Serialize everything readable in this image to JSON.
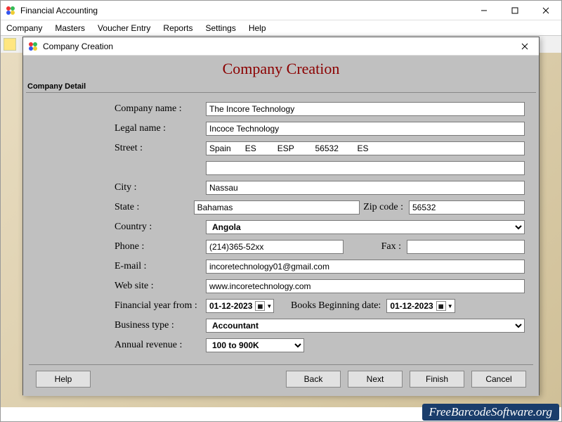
{
  "mainWindow": {
    "title": "Financial Accounting"
  },
  "menubar": {
    "items": [
      "Company",
      "Masters",
      "Voucher Entry",
      "Reports",
      "Settings",
      "Help"
    ]
  },
  "dialog": {
    "title": "Company Creation",
    "heading": "Company Creation",
    "groupLabel": "Company Detail"
  },
  "labels": {
    "companyName": "Company name :",
    "legalName": "Legal name :",
    "street": "Street :",
    "city": "City :",
    "state": "State :",
    "zip": "Zip code :",
    "country": "Country :",
    "phone": "Phone :",
    "fax": "Fax :",
    "email": "E-mail :",
    "website": "Web site :",
    "fyFrom": "Financial year from :",
    "booksBegin": "Books Beginning date:",
    "businessType": "Business type :",
    "annualRevenue": "Annual revenue :"
  },
  "values": {
    "companyName": "The Incore Technology",
    "legalName": "Incoce Technology",
    "street1": "Spain      ES         ESP         56532        ES",
    "street2": "",
    "city": "Nassau",
    "state": "Bahamas",
    "zip": "56532",
    "country": "Angola",
    "phone": "(214)365-52xx",
    "fax": "",
    "email": "incoretechnology01@gmail.com",
    "website": "www.incoretechnology.com",
    "fyFrom": "01-12-2023",
    "booksBegin": "01-12-2023",
    "businessType": "Accountant",
    "annualRevenue": "100 to 900K"
  },
  "buttons": {
    "help": "Help",
    "back": "Back",
    "next": "Next",
    "finish": "Finish",
    "cancel": "Cancel"
  },
  "watermark": "FreeBarcodeSoftware.org"
}
